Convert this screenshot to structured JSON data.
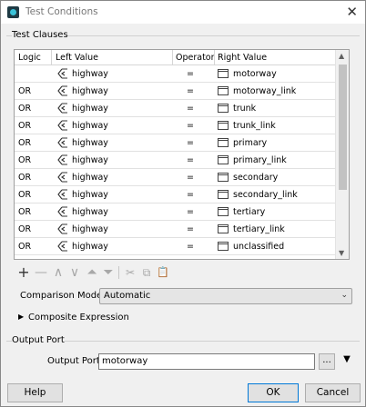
{
  "window": {
    "title": "Test Conditions",
    "close_glyph": "✕"
  },
  "test_clauses": {
    "label": "Test Clauses",
    "headers": {
      "logic": "Logic",
      "left": "Left Value",
      "operator": "Operator",
      "right": "Right Value"
    },
    "rows": [
      {
        "logic": "",
        "left": "highway",
        "op": "=",
        "right": "motorway"
      },
      {
        "logic": "OR",
        "left": "highway",
        "op": "=",
        "right": "motorway_link"
      },
      {
        "logic": "OR",
        "left": "highway",
        "op": "=",
        "right": "trunk"
      },
      {
        "logic": "OR",
        "left": "highway",
        "op": "=",
        "right": "trunk_link"
      },
      {
        "logic": "OR",
        "left": "highway",
        "op": "=",
        "right": "primary"
      },
      {
        "logic": "OR",
        "left": "highway",
        "op": "=",
        "right": "primary_link"
      },
      {
        "logic": "OR",
        "left": "highway",
        "op": "=",
        "right": "secondary"
      },
      {
        "logic": "OR",
        "left": "highway",
        "op": "=",
        "right": "secondary_link"
      },
      {
        "logic": "OR",
        "left": "highway",
        "op": "=",
        "right": "tertiary"
      },
      {
        "logic": "OR",
        "left": "highway",
        "op": "=",
        "right": "tertiary_link"
      },
      {
        "logic": "OR",
        "left": "highway",
        "op": "=",
        "right": "unclassified"
      }
    ]
  },
  "toolbar": {
    "add": "+",
    "remove": "—",
    "move_up": "∧",
    "move_down": "∨",
    "move_top": "⏶",
    "move_bottom": "⏷",
    "cut": "✂",
    "copy": "⧉",
    "paste": "📋"
  },
  "comparison": {
    "label": "Comparison Mode:",
    "value": "Automatic"
  },
  "composite": {
    "label": "Composite Expression"
  },
  "output_port": {
    "group_label": "Output Port",
    "label": "Output Port:",
    "value": "motorway",
    "ellipsis": "...",
    "dropdown": "▼"
  },
  "buttons": {
    "help": "Help",
    "ok": "OK",
    "cancel": "Cancel"
  }
}
